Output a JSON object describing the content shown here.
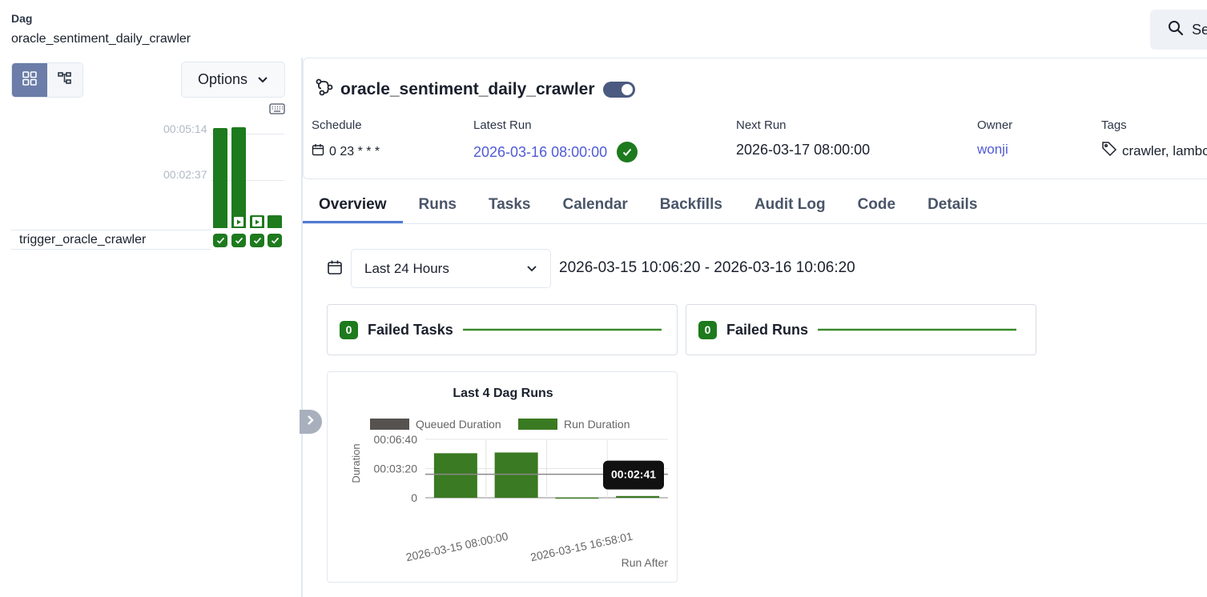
{
  "breadcrumb": {
    "label": "Dag",
    "value": "oracle_sentiment_daily_crawler"
  },
  "search": {
    "label": "Se"
  },
  "left": {
    "options_label": "Options",
    "grid_ticks": [
      "00:05:14",
      "00:02:37"
    ],
    "runs": [
      {
        "duration_fraction": 0.99,
        "state": "success",
        "playing": false
      },
      {
        "duration_fraction": 1.0,
        "state": "success",
        "playing": true
      },
      {
        "duration_fraction": 0.1,
        "state": "success",
        "playing": true
      },
      {
        "duration_fraction": 0.1,
        "state": "success",
        "playing": false
      }
    ],
    "task_name": "trigger_oracle_crawler"
  },
  "dag": {
    "title": "oracle_sentiment_daily_crawler",
    "paused": false,
    "schedule_label": "Schedule",
    "schedule_value": "0 23 * * *",
    "latest_run_label": "Latest Run",
    "latest_run_value": "2026-03-16 08:00:00",
    "next_run_label": "Next Run",
    "next_run_value": "2026-03-17 08:00:00",
    "owner_label": "Owner",
    "owner_value": "wonji",
    "tags_label": "Tags",
    "tags_value": "crawler, lambo"
  },
  "tabs": [
    "Overview",
    "Runs",
    "Tasks",
    "Calendar",
    "Backfills",
    "Audit Log",
    "Code",
    "Details"
  ],
  "overview": {
    "range_option": "Last 24 Hours",
    "range_text": "2026-03-15 10:06:20 - 2026-03-16 10:06:20",
    "failed_tasks": {
      "count": "0",
      "label": "Failed Tasks"
    },
    "failed_runs": {
      "count": "0",
      "label": "Failed Runs"
    }
  },
  "colors": {
    "success": "#1d7a1d",
    "accent": "#4f5bd5",
    "chart_run": "#3a7a22",
    "chart_queued": "#555250"
  },
  "chart_data": {
    "type": "bar",
    "title": "Last 4 Dag Runs",
    "xlabel": "Run After",
    "ylabel": "Duration",
    "categories": [
      "2026-03-15 08:00:00",
      "2026-03-15 16:58:01",
      "",
      ""
    ],
    "tick_labels_shown": [
      "2026-03-15 08:00:00",
      "2026-03-15 16:58:01"
    ],
    "y_ticks": [
      "00:06:40",
      "00:03:20",
      "0"
    ],
    "ylim_seconds": [
      0,
      400
    ],
    "series": [
      {
        "name": "Queued Duration",
        "values": [
          0,
          0,
          0,
          0
        ]
      },
      {
        "name": "Run Duration",
        "values": [
          305,
          310,
          2,
          12
        ]
      }
    ],
    "reference_line_seconds": 161,
    "tooltip": "00:02:41",
    "legend": "top"
  }
}
